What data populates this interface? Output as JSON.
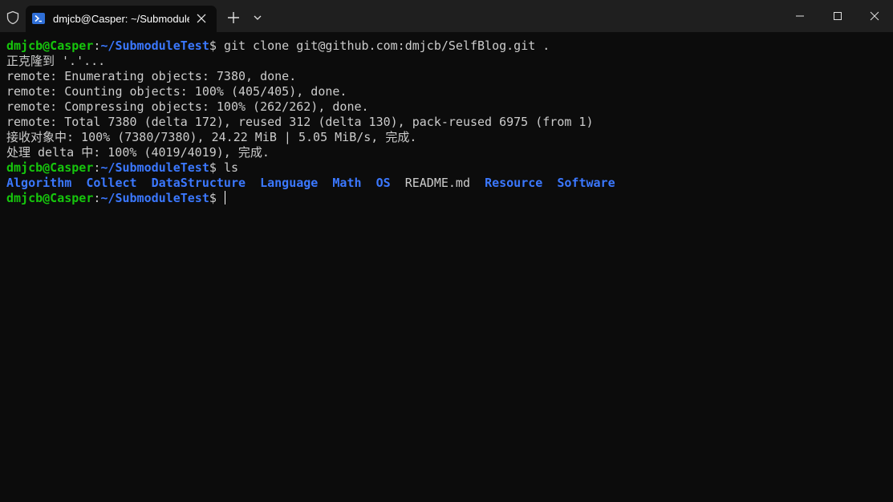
{
  "window": {
    "tab_title": "dmjcb@Casper: ~/Submodule",
    "icons": {
      "shield": "shield-icon",
      "tab": "powershell-icon",
      "close_tab": "close-icon",
      "new_tab": "plus-icon",
      "dropdown": "chevron-down-icon",
      "minimize": "minimize-icon",
      "maximize": "maximize-icon",
      "close": "close-icon"
    }
  },
  "prompt": {
    "user_host": "dmjcb@Casper",
    "separator": ":",
    "path": "~/SubmoduleTest",
    "dollar": "$ "
  },
  "commands": {
    "clone": "git clone git@github.com:dmjcb/SelfBlog.git .",
    "ls": "ls"
  },
  "output": [
    "正克隆到 '.'...",
    "remote: Enumerating objects: 7380, done.",
    "remote: Counting objects: 100% (405/405), done.",
    "remote: Compressing objects: 100% (262/262), done.",
    "remote: Total 7380 (delta 172), reused 312 (delta 130), pack-reused 6975 (from 1)",
    "接收对象中: 100% (7380/7380), 24.22 MiB | 5.05 MiB/s, 完成.",
    "处理 delta 中: 100% (4019/4019), 完成."
  ],
  "ls_entries": [
    {
      "name": "Algorithm",
      "type": "dir"
    },
    {
      "name": "Collect",
      "type": "dir"
    },
    {
      "name": "DataStructure",
      "type": "dir"
    },
    {
      "name": "Language",
      "type": "dir"
    },
    {
      "name": "Math",
      "type": "dir"
    },
    {
      "name": "OS",
      "type": "dir"
    },
    {
      "name": "README.md",
      "type": "file"
    },
    {
      "name": "Resource",
      "type": "dir"
    },
    {
      "name": "Software",
      "type": "dir"
    }
  ],
  "colors": {
    "background": "#0c0c0c",
    "titlebar": "#1f1f1f",
    "user_host": "#16c60c",
    "path": "#3b78ff",
    "directory": "#3b78ff",
    "text": "#cccccc"
  }
}
